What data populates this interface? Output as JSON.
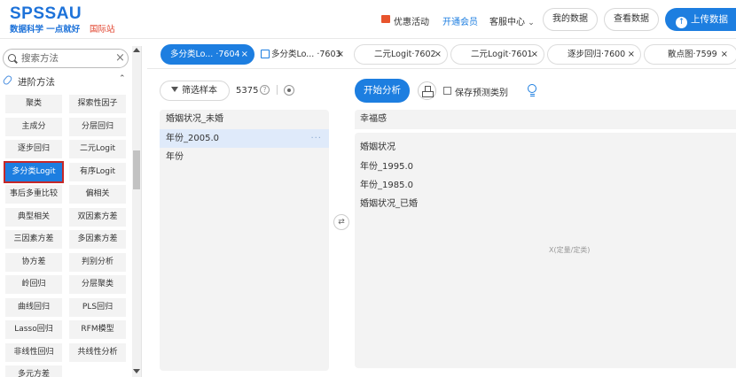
{
  "header": {
    "logo_main": "SPSSAU",
    "logo_sub": "数据科学 一点就好",
    "logo_intl": "国际站",
    "promo": "优惠活动",
    "vip": "开通会员",
    "support": "客服中心",
    "support_chevron": "⌄",
    "my_data": "我的数据",
    "view_data": "查看数据",
    "upload": "上传数据",
    "vip_color": "#1d7ee0"
  },
  "sidebar": {
    "search_placeholder": "搜索方法",
    "search_clear": "×",
    "section_title": "进阶方法",
    "section_chevron": "⌃",
    "methods": [
      [
        "聚类",
        "探索性因子"
      ],
      [
        "主成分",
        "分层回归"
      ],
      [
        "逐步回归",
        "二元Logit"
      ],
      [
        "多分类Logit",
        "有序Logit"
      ],
      [
        "事后多重比较",
        "偏相关"
      ],
      [
        "典型相关",
        "双因素方差"
      ],
      [
        "三因素方差",
        "多因素方差"
      ],
      [
        "协方差",
        "判别分析"
      ],
      [
        "岭回归",
        "分层聚类"
      ],
      [
        "曲线回归",
        "PLS回归"
      ],
      [
        "Lasso回归",
        "RFM模型"
      ],
      [
        "非线性回归",
        "共线性分析"
      ],
      [
        "多元方差",
        ""
      ]
    ],
    "active_method": "多分类Logit"
  },
  "tabs": [
    {
      "label": "多分类Lo... ·7604",
      "close": "×"
    },
    {
      "label": "多分类Lo... ·7603",
      "close": "×"
    },
    {
      "label": "二元Logit·7602",
      "close": "×"
    },
    {
      "label": "二元Logit·7601",
      "close": "×"
    },
    {
      "label": "逐步回归·7600",
      "close": "×"
    },
    {
      "label": "散点图·7599",
      "close": "×"
    }
  ],
  "left_panel": {
    "filter_label": "筛选样本",
    "sample_count": "5375",
    "help": "?",
    "variables": [
      "婚姻状况_未婚",
      "年份_2005.0",
      "年份"
    ],
    "selected_index": 1,
    "more": "···"
  },
  "swap": "⇄",
  "analysis": {
    "start_label": "开始分析",
    "save_pred_label": "保存预测类别",
    "y_variable": "幸福感",
    "x_variables": [
      "婚姻状况",
      "年份_1995.0",
      "年份_1985.0",
      "婚姻状况_已婚"
    ],
    "x_placeholder": "X(定量/定类)"
  }
}
